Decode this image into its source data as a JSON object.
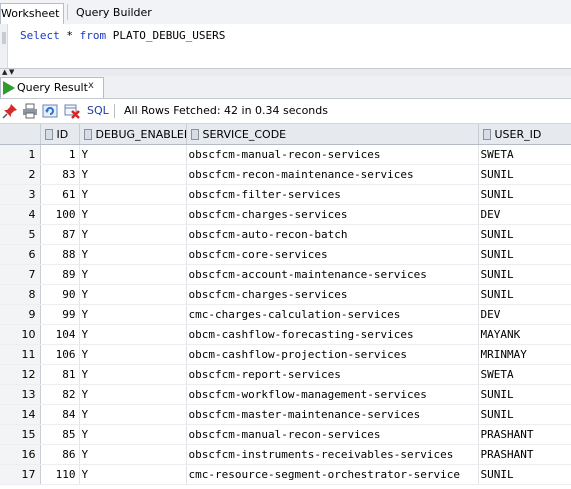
{
  "tabs": {
    "worksheet": "Worksheet",
    "query_builder": "Query Builder"
  },
  "editor": {
    "kw_select": "Select",
    "rest1": " * ",
    "kw_from": "from",
    "rest2": " PLATO_DEBUG_USERS"
  },
  "result_tab": {
    "label": "Query Result",
    "close": "x"
  },
  "toolbar": {
    "sql_link": "SQL",
    "status": "All Rows Fetched: 42 in 0.34 seconds"
  },
  "columns": [
    "ID",
    "DEBUG_ENABLED",
    "SERVICE_CODE",
    "USER_ID"
  ],
  "rows": [
    {
      "n": "1",
      "id": "1",
      "debug": "Y",
      "service": "obscfcm-manual-recon-services",
      "user": "SWETA"
    },
    {
      "n": "2",
      "id": "83",
      "debug": "Y",
      "service": "obscfcm-recon-maintenance-services",
      "user": "SUNIL"
    },
    {
      "n": "3",
      "id": "61",
      "debug": "Y",
      "service": "obscfcm-filter-services",
      "user": "SUNIL"
    },
    {
      "n": "4",
      "id": "100",
      "debug": "Y",
      "service": "obscfcm-charges-services",
      "user": "DEV"
    },
    {
      "n": "5",
      "id": "87",
      "debug": "Y",
      "service": "obscfcm-auto-recon-batch",
      "user": "SUNIL"
    },
    {
      "n": "6",
      "id": "88",
      "debug": "Y",
      "service": "obscfcm-core-services",
      "user": "SUNIL"
    },
    {
      "n": "7",
      "id": "89",
      "debug": "Y",
      "service": "obscfcm-account-maintenance-services",
      "user": "SUNIL"
    },
    {
      "n": "8",
      "id": "90",
      "debug": "Y",
      "service": "obscfcm-charges-services",
      "user": "SUNIL"
    },
    {
      "n": "9",
      "id": "99",
      "debug": "Y",
      "service": "cmc-charges-calculation-services",
      "user": "DEV"
    },
    {
      "n": "10",
      "id": "104",
      "debug": "Y",
      "service": "obcm-cashflow-forecasting-services",
      "user": "MAYANK"
    },
    {
      "n": "11",
      "id": "106",
      "debug": "Y",
      "service": "obcm-cashflow-projection-services",
      "user": "MRINMAY"
    },
    {
      "n": "12",
      "id": "81",
      "debug": "Y",
      "service": "obscfcm-report-services",
      "user": "SWETA"
    },
    {
      "n": "13",
      "id": "82",
      "debug": "Y",
      "service": "obscfcm-workflow-management-services",
      "user": "SUNIL"
    },
    {
      "n": "14",
      "id": "84",
      "debug": "Y",
      "service": "obscfcm-master-maintenance-services",
      "user": "SUNIL"
    },
    {
      "n": "15",
      "id": "85",
      "debug": "Y",
      "service": "obscfcm-manual-recon-services",
      "user": "PRASHANT"
    },
    {
      "n": "16",
      "id": "86",
      "debug": "Y",
      "service": "obscfcm-instruments-receivables-services",
      "user": "PRASHANT"
    },
    {
      "n": "17",
      "id": "110",
      "debug": "Y",
      "service": "cmc-resource-segment-orchestrator-service",
      "user": "SUNIL"
    }
  ]
}
